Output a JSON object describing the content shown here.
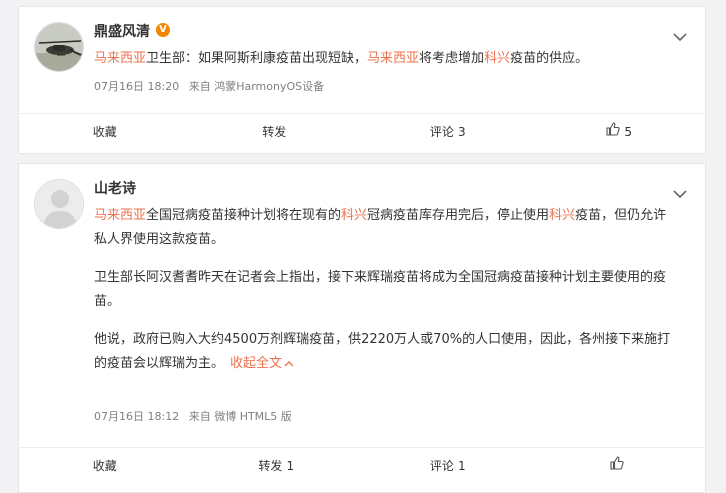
{
  "posts": [
    {
      "username": "鼎盛风清",
      "verified_badge": "V",
      "content": [
        [
          {
            "t": "马来西亚",
            "c": "red"
          },
          {
            "t": "卫生部：如果阿斯利康疫苗出现短缺，"
          },
          {
            "t": "马来西亚",
            "c": "red"
          },
          {
            "t": "将考虑增加"
          },
          {
            "t": "科兴",
            "c": "red"
          },
          {
            "t": "疫苗的供应。"
          }
        ]
      ],
      "date": "07月16日 18:20",
      "source": "来自 鸿蒙HarmonyOS设备",
      "actions": {
        "favorite_label": "收藏",
        "repost_label": "转发",
        "repost_count": "",
        "comment_label": "评论",
        "comment_count": "3",
        "like_count": "5"
      }
    },
    {
      "username": "山老诗",
      "content": [
        [
          {
            "t": "马来西亚",
            "c": "red"
          },
          {
            "t": "全国冠病疫苗接种计划将在现有的"
          },
          {
            "t": "科兴",
            "c": "red"
          },
          {
            "t": "冠病疫苗库存用完后，停止使用"
          },
          {
            "t": "科兴",
            "c": "red"
          },
          {
            "t": "疫苗，但仍允许私人界使用这款疫苗。"
          }
        ],
        [
          {
            "t": "卫生部长阿汉耆耆昨天在记者会上指出，接下来辉瑞疫苗将成为全国冠病疫苗接种计划主要使用的疫苗。"
          }
        ],
        [
          {
            "t": "他说，政府已购入大约4500万剂辉瑞疫苗，供2220万人或70%的人口使用，因此，各州接下来施打的疫苗会以辉瑞为主。"
          }
        ]
      ],
      "collapse_label": "收起全文",
      "date": "07月16日 18:12",
      "source": "来自 微博 HTML5 版",
      "actions": {
        "favorite_label": "收藏",
        "repost_label": "转发",
        "repost_count": "1",
        "comment_label": "评论",
        "comment_count": "1",
        "like_count": ""
      }
    }
  ],
  "colors": {
    "topic_red": "#eb7350",
    "verified_orange": "#f08700",
    "meta_gray": "#808080",
    "page_bg": "#f2f2f5"
  },
  "icons": [
    "chevron-down-icon",
    "thumbs-up-icon",
    "verified-badge-icon"
  ]
}
